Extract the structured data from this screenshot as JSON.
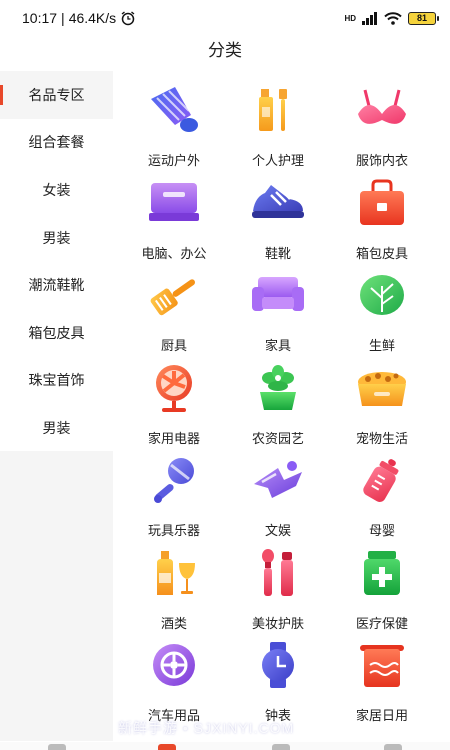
{
  "status_bar": {
    "time": "10:17",
    "separator": "|",
    "speed": "46.4K/s",
    "network": "HD",
    "battery": "81"
  },
  "page": {
    "title": "分类"
  },
  "sidebar": {
    "items": [
      {
        "label": "名品专区"
      },
      {
        "label": "组合套餐"
      },
      {
        "label": "女装"
      },
      {
        "label": "男装"
      },
      {
        "label": "潮流鞋靴"
      },
      {
        "label": "箱包皮具"
      },
      {
        "label": "珠宝首饰"
      },
      {
        "label": "男装"
      }
    ]
  },
  "categories": [
    {
      "label": "运动户外",
      "icon": "badminton-shuttlecock-icon"
    },
    {
      "label": "个人护理",
      "icon": "toothbrush-toothpaste-icon"
    },
    {
      "label": "服饰内衣",
      "icon": "bra-icon"
    },
    {
      "label": "电脑、办公",
      "icon": "laptop-icon"
    },
    {
      "label": "鞋靴",
      "icon": "sneaker-icon"
    },
    {
      "label": "箱包皮具",
      "icon": "handbag-icon"
    },
    {
      "label": "厨具",
      "icon": "spatula-icon"
    },
    {
      "label": "家具",
      "icon": "sofa-icon"
    },
    {
      "label": "生鲜",
      "icon": "cabbage-icon"
    },
    {
      "label": "家用电器",
      "icon": "electric-fan-icon"
    },
    {
      "label": "农资园艺",
      "icon": "potted-plant-icon"
    },
    {
      "label": "宠物生活",
      "icon": "pet-bowl-icon"
    },
    {
      "label": "玩具乐器",
      "icon": "rattle-toy-icon"
    },
    {
      "label": "文娱",
      "icon": "ticket-icon"
    },
    {
      "label": "母婴",
      "icon": "baby-bottle-icon"
    },
    {
      "label": "酒类",
      "icon": "wine-bottle-glass-icon"
    },
    {
      "label": "美妆护肤",
      "icon": "makeup-brush-icon"
    },
    {
      "label": "医疗保健",
      "icon": "medicine-bottle-icon"
    },
    {
      "label": "汽车用品",
      "icon": "car-wheel-icon"
    },
    {
      "label": "钟表",
      "icon": "wristwatch-icon"
    },
    {
      "label": "家居日用",
      "icon": "towel-icon"
    }
  ],
  "watermark": "新鲜手游 • SJXINYI.COM",
  "colors": {
    "accent": "#e8482a",
    "sidebar_bg": "#f5f5f5"
  }
}
